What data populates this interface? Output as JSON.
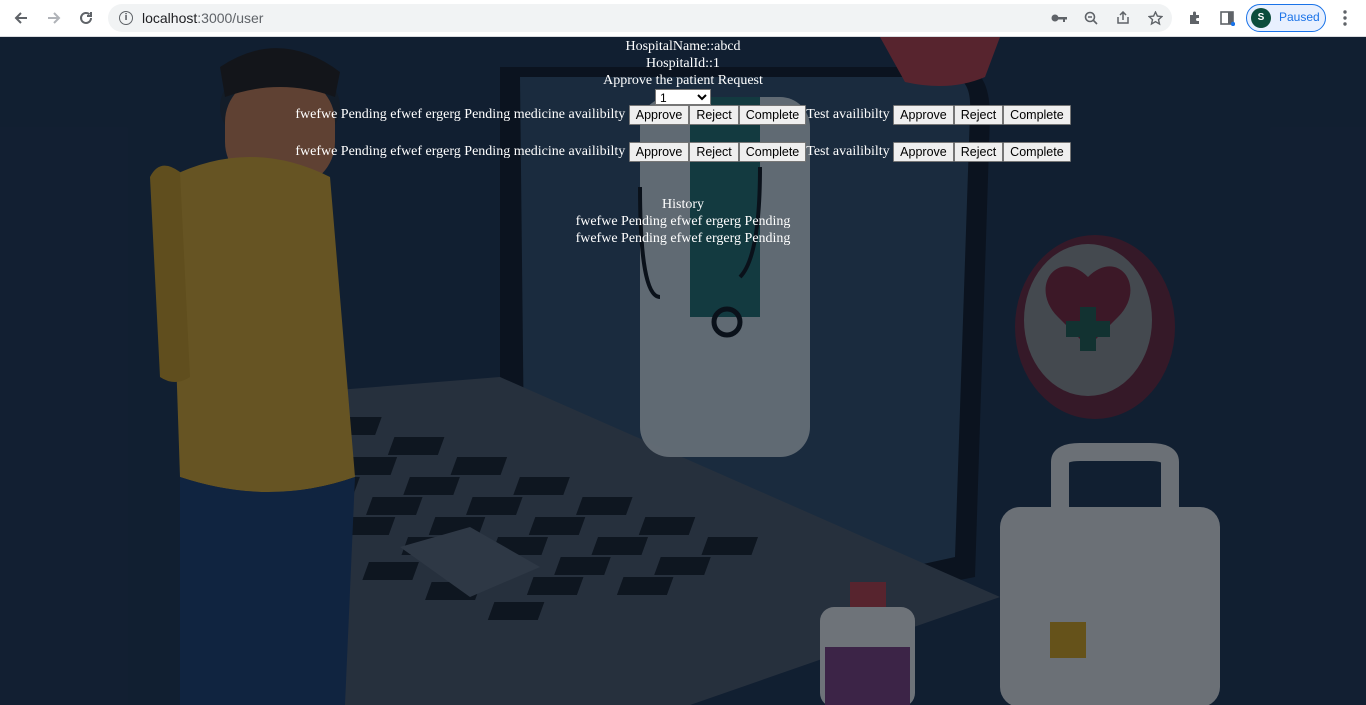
{
  "browser": {
    "url_host": "localhost",
    "url_path": ":3000/user",
    "profile_initial": "S",
    "profile_status": "Paused"
  },
  "hospital": {
    "name_line": "HospitalName::abcd",
    "id_line": "HospitalId::1"
  },
  "approve_heading": "Approve the patient Request",
  "patient_select": {
    "selected": "1"
  },
  "requests": [
    {
      "text": "fwefwe Pending efwef ergerg Pending medicine availibilty",
      "medicine_buttons": [
        "Approve",
        "Reject",
        "Complete"
      ],
      "test_label": "Test availibilty",
      "test_buttons": [
        "Approve",
        "Reject",
        "Complete"
      ]
    },
    {
      "text": "fwefwe Pending efwef ergerg Pending medicine availibilty",
      "medicine_buttons": [
        "Approve",
        "Reject",
        "Complete"
      ],
      "test_label": "Test availibilty",
      "test_buttons": [
        "Approve",
        "Reject",
        "Complete"
      ]
    }
  ],
  "history": {
    "title": "History",
    "items": [
      "fwefwe Pending efwef ergerg Pending",
      "fwefwe Pending efwef ergerg Pending"
    ]
  },
  "colors": {
    "page_background": "#16253a",
    "text": "#ffffff"
  }
}
